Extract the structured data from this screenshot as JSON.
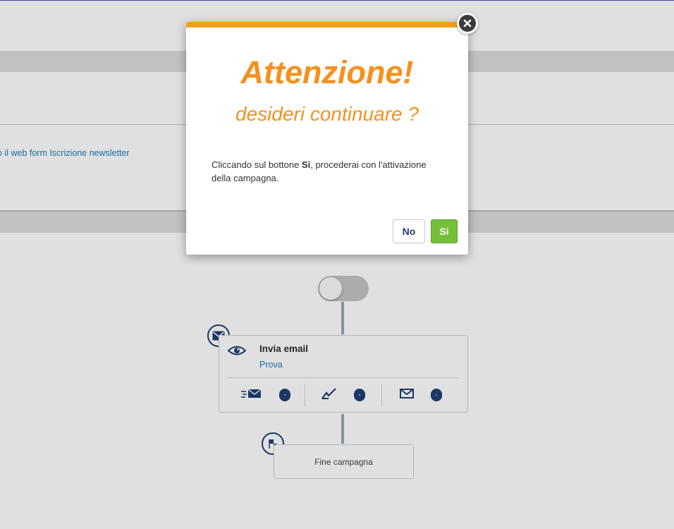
{
  "background": {
    "form_link": "o il web form Iscrizione newsletter",
    "step": {
      "title": "Invia email",
      "subtitle": "Prova",
      "stats": [
        {
          "icon": "sent-mail-icon",
          "value": "-"
        },
        {
          "icon": "open-mail-icon",
          "value": "-"
        },
        {
          "icon": "envelope-icon",
          "value": "-"
        }
      ]
    },
    "end_step": {
      "label": "Fine campagna"
    }
  },
  "modal": {
    "title": "Attenzione!",
    "subtitle": "desideri continuare ?",
    "body_prefix": "Cliccando sul bottone ",
    "body_bold": "Si",
    "body_suffix": ", procederai con l'attivazione della campagna.",
    "no_label": "No",
    "si_label": "Si"
  },
  "colors": {
    "accent_orange": "#f5901e",
    "confirm_green": "#76bf3b",
    "navy": "#1f3f73",
    "link_blue": "#1f7dbf"
  }
}
